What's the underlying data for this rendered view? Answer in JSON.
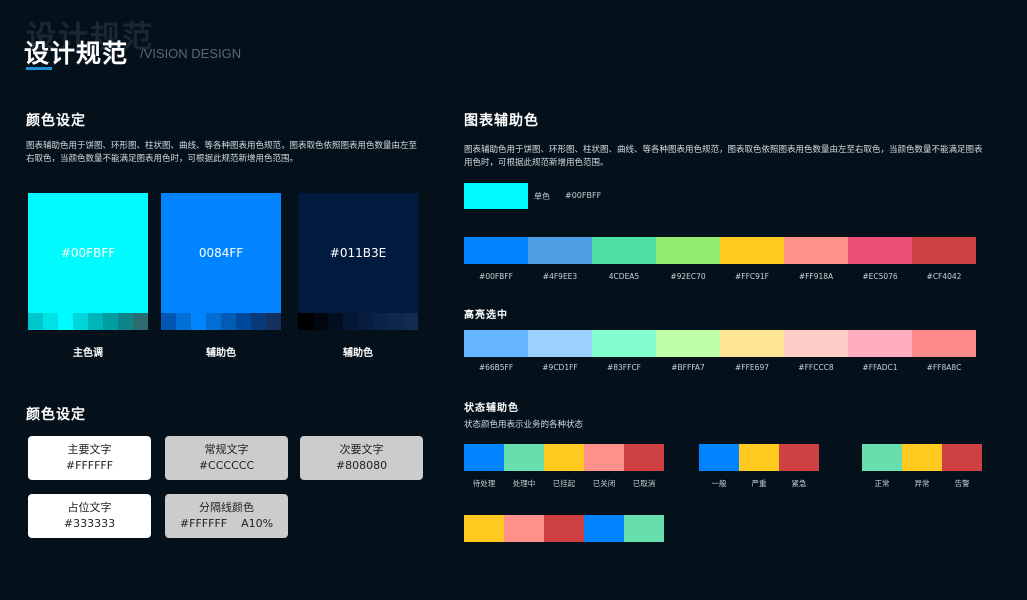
{
  "header": {
    "watermark": "设计规范",
    "title": "设计规范",
    "subtitle": "/VISION DESIGN"
  },
  "colors": {
    "heading": "颜色设定",
    "description": "图表辅助色用于饼图、环形图、柱状图、曲线、等各种图表用色规范，图表取色依照图表用色数量由左至右取色，当颜色数量不能满足图表用色时，可根据此规范新增用色范围。",
    "swatches": [
      {
        "code": "#00FBFF",
        "caption": "主色调",
        "color": "#00fbff",
        "shades": [
          "#00c7cc",
          "#00e1e6",
          "#00fbff",
          "#00d5d9",
          "#00b5b9",
          "#009ea1",
          "#0f858a",
          "#2b6c70"
        ]
      },
      {
        "code": "0084FF",
        "caption": "辅助色",
        "color": "#0084ff",
        "shades": [
          "#0057b3",
          "#0070d6",
          "#0084ff",
          "#006ed4",
          "#005cb5",
          "#00489a",
          "#083a7a",
          "#13305e"
        ]
      },
      {
        "code": "#011B3E",
        "caption": "辅助色",
        "color": "#011b3e",
        "shades": [
          "#000000",
          "#01060f",
          "#020f22",
          "#041734",
          "#061d3f",
          "#0a2246",
          "#0e274c",
          "#122b50"
        ]
      }
    ]
  },
  "text_colors": {
    "heading": "颜色设定",
    "cards": [
      {
        "name": "主要文字",
        "value": "#FFFFFF",
        "bg": "#ffffff"
      },
      {
        "name": "常规文字",
        "value": "#CCCCCC",
        "bg": "#cccccc"
      },
      {
        "name": "次要文字",
        "value": "#808080",
        "bg": "#cccccc"
      },
      {
        "name": "占位文字",
        "value": "#333333",
        "bg": "#ffffff"
      },
      {
        "name": "分隔线颜色",
        "value": "#FFFFFF    A10%",
        "bg": "#cccccc"
      }
    ]
  },
  "chart_colors": {
    "heading": "图表辅助色",
    "description": "图表辅助色用于饼图、环形图、柱状图、曲线、等各种图表用色规范，图表取色依照图表用色数量由左至右取色，当颜色数量不能满足图表用色时，可根据此规范新增用色范围。",
    "single": {
      "label": "单色",
      "code": "#00FBFF",
      "color": "#00fbff"
    },
    "palette": [
      {
        "code": "#00FBFF",
        "color": "#0084ff"
      },
      {
        "code": "#4F9EE3",
        "color": "#4f9ee3"
      },
      {
        "code": "4CDEA5",
        "color": "#4cdea5"
      },
      {
        "code": "#92EC70",
        "color": "#92ec70"
      },
      {
        "code": "#FFC91F",
        "color": "#ffc91f"
      },
      {
        "code": "#FF918A",
        "color": "#ff918a"
      },
      {
        "code": "#EC5076",
        "color": "#ec5076"
      },
      {
        "code": "#CF4042",
        "color": "#cf4042"
      }
    ],
    "highlight_heading": "高亮选中",
    "highlight": [
      {
        "code": "#66B5FF",
        "color": "#66b5ff"
      },
      {
        "code": "#9CD1FF",
        "color": "#9cd1ff"
      },
      {
        "code": "#83FFCF",
        "color": "#83ffcf"
      },
      {
        "code": "#BFFFA7",
        "color": "#bfffa7"
      },
      {
        "code": "#FFE697",
        "color": "#ffe697"
      },
      {
        "code": "#FFCCC8",
        "color": "#ffccc8"
      },
      {
        "code": "#FFADC1",
        "color": "#ffadc1"
      },
      {
        "code": "#FF8A8C",
        "color": "#ff8a8c"
      }
    ],
    "status_heading": "状态辅助色",
    "status_description": "状态颜色用表示业务的各种状态",
    "status_group1": [
      {
        "label": "待处理",
        "color": "#0084ff"
      },
      {
        "label": "处理中",
        "color": "#66deae"
      },
      {
        "label": "已挂起",
        "color": "#ffc91f"
      },
      {
        "label": "已关闭",
        "color": "#ff918a"
      },
      {
        "label": "已取消",
        "color": "#cf4042"
      }
    ],
    "status_group2": [
      {
        "label": "一般",
        "color": "#0084ff"
      },
      {
        "label": "严重",
        "color": "#ffc91f"
      },
      {
        "label": "紧急",
        "color": "#cf4042"
      }
    ],
    "status_group3": [
      {
        "label": "正常",
        "color": "#66deae"
      },
      {
        "label": "异常",
        "color": "#ffc91f"
      },
      {
        "label": "告警",
        "color": "#cf4042"
      }
    ],
    "status_group4": [
      "#ffc91f",
      "#ff918a",
      "#cf4042",
      "#0084ff",
      "#66deae"
    ]
  }
}
